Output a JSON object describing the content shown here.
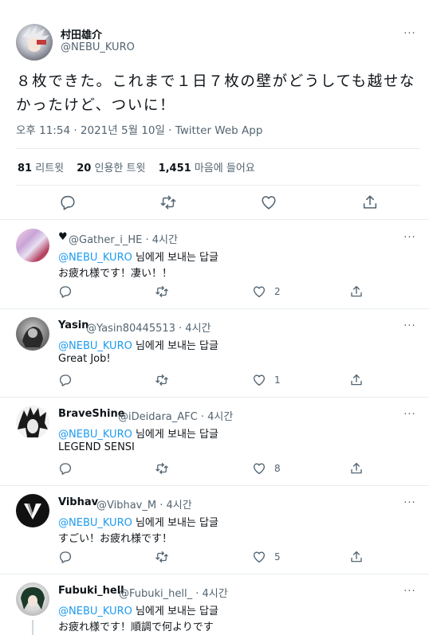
{
  "main_tweet": {
    "author_name": "村田雄介",
    "author_handle": "@NEBU_KURO",
    "text": "８枚できた。これまで１日７枚の壁がどうしても越せなかったけど、ついに！",
    "timestamp": "오후 11:54 · 2021년 5월 10일 · Twitter Web App",
    "stats": {
      "retweets_count": "81",
      "retweets_label": "리트윗",
      "quotes_count": "20",
      "quotes_label": "인용한 트윗",
      "likes_count": "1,451",
      "likes_label": "마음에 들어요"
    }
  },
  "more_label": "···",
  "reply_prefix": "님에게 보내는 답글",
  "replies": [
    {
      "name": "♥",
      "handle": "@Gather_i_HE · 4시간",
      "mention": "@NEBU_KURO",
      "text": "お疲れ様です！凄い！！",
      "likes": "2"
    },
    {
      "name": "Yasin",
      "handle": "@Yasin80445513 · 4시간",
      "mention": "@NEBU_KURO",
      "text": "Great Job!",
      "likes": "1"
    },
    {
      "name": "BraveShine",
      "handle": "@iDeidara_AFC · 4시간",
      "mention": "@NEBU_KURO",
      "text": "LEGEND SENSI",
      "likes": "8"
    },
    {
      "name": "Vibhav",
      "handle": "@Vibhav_M · 4시간",
      "mention": "@NEBU_KURO",
      "text": "すごい！お疲れ様です！",
      "likes": "5"
    },
    {
      "name": "Fubuki_hell",
      "handle": "@Fubuki_hell_ · 4시간",
      "mention": "@NEBU_KURO",
      "text": "お疲れ様です！順調で何よりです",
      "likes": ""
    }
  ],
  "colors": {
    "accent": "#1d9bf0",
    "text_primary": "#0f1419",
    "text_secondary": "#536471",
    "divider": "#e6ecf0"
  },
  "icons": [
    "reply-icon",
    "retweet-icon",
    "like-icon",
    "share-icon",
    "more-icon"
  ]
}
